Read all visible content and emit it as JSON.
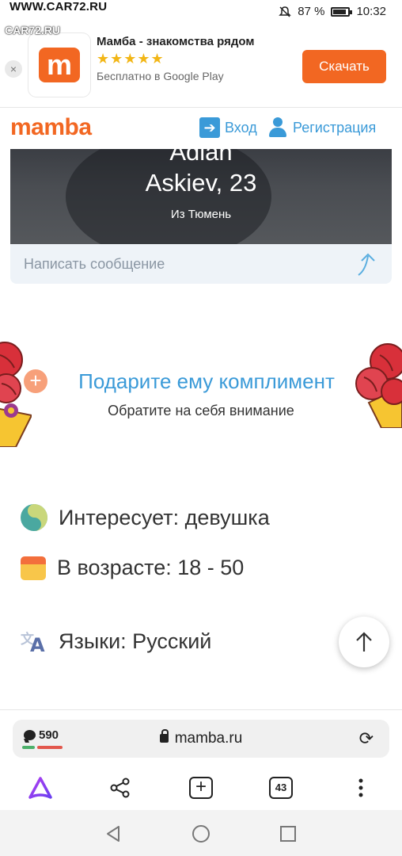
{
  "status_bar": {
    "watermark": "WWW.CAR72.RU",
    "watermark_2": "CAR72.RU",
    "battery": "87 %",
    "time": "10:32"
  },
  "ad": {
    "close": "×",
    "title": "Мамба - знакомства рядом",
    "stars": "★★★★★",
    "subtitle": "Бесплатно в Google Play",
    "icon_letter": "m",
    "button": "Скачать",
    "rating": 4.5
  },
  "header": {
    "logo": "mamba",
    "login": "Вход",
    "register": "Регистрация"
  },
  "profile": {
    "name_line1": "Adlan",
    "name_line2": "Askiev, 23",
    "city": "Из Тюмень",
    "message_placeholder": "Написать сообщение"
  },
  "compliment": {
    "title": "Подарите ему комплимент",
    "subtitle": "Обратите на себя внимание"
  },
  "info": {
    "interest": "Интересует: девушка",
    "age": "В возрасте: 18 - 50",
    "languages": "Языки: Русский"
  },
  "browser": {
    "message_count": "590",
    "url": "mamba.ru",
    "tabs_count": "43"
  },
  "colors": {
    "brand_orange": "#f26722",
    "link_blue": "#3a9ad8"
  }
}
